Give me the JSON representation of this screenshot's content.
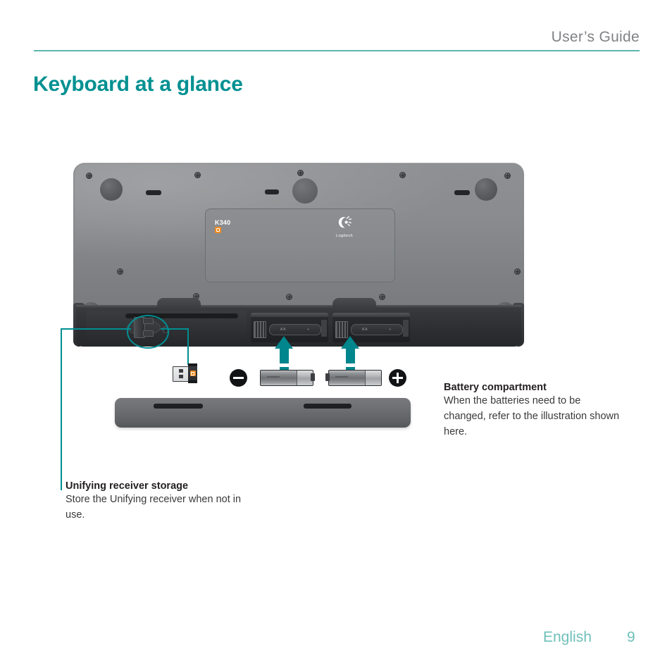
{
  "header": {
    "title": "User’s Guide",
    "rule_color": "#5cb6ae"
  },
  "page": {
    "title": "Keyboard at a glance",
    "title_color": "#009091"
  },
  "device": {
    "label_panel": {
      "model": "K340",
      "brand": "Logitech",
      "unifying_badge_color": "#f08b1d"
    },
    "battery_bay_markings": [
      {
        "type": "AA",
        "polarity": "+"
      },
      {
        "type": "AA",
        "polarity": "+"
      }
    ]
  },
  "figure": {
    "accent_color": "#008e92",
    "polarity_minus": "−",
    "polarity_plus": "+",
    "battery_label_left": "AA",
    "battery_label_right": "AA",
    "battery_polarity_mark_left": "+",
    "battery_polarity_mark_right": "+"
  },
  "notes": {
    "battery": {
      "title": "Battery compartment",
      "body": "When the batteries need to be changed, refer to the illustration shown here."
    },
    "receiver": {
      "title": "Unifying receiver storage",
      "body": "Store the Unifying receiver when not in use."
    }
  },
  "footer": {
    "language": "English",
    "page_number": "9",
    "color": "#6fc0ba"
  }
}
